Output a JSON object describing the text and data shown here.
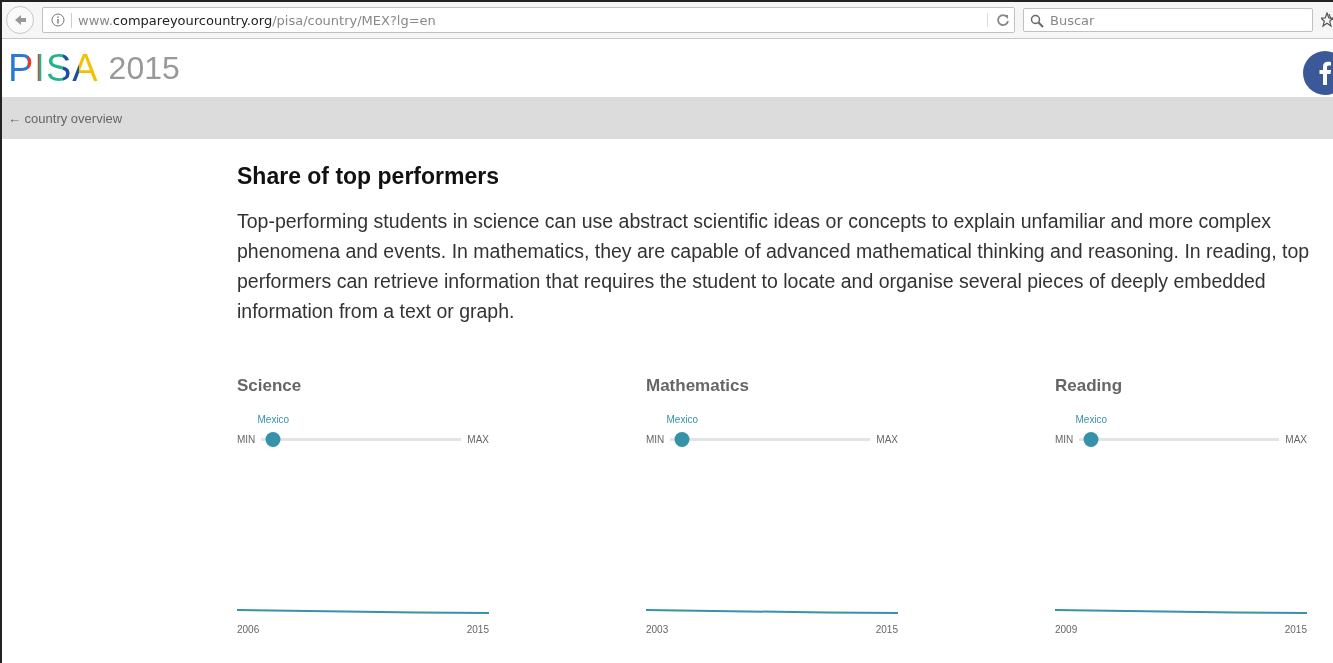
{
  "browser": {
    "url": "www.**compareyourcountry.org**/pisa/country/MEX?lg=en",
    "search": {
      "placeholder": "Buscar"
    }
  },
  "header": {
    "logo": "PISA",
    "year": "2015"
  },
  "nav": {
    "back_link": "← country overview"
  },
  "section": {
    "title": "Share of top performers",
    "description": "Top-performing students in science can use abstract scientific ideas or concepts to explain unfamiliar and more complex phenomena and events. In mathematics, they are capable of advanced mathematical thinking and reasoning. In reading, top performers can retrieve information that requires the student to locate and organise several pieces of deeply embedded information from a text or graph."
  },
  "panels": [
    {
      "title": "Science",
      "country": "Mexico",
      "min_label": "MIN",
      "max_label": "MAX",
      "level": 0.06,
      "start_year": "2006",
      "end_year": "2015"
    },
    {
      "title": "Mathematics",
      "country": "Mexico",
      "min_label": "MIN",
      "max_label": "MAX",
      "level": 0.06,
      "start_year": "2003",
      "end_year": "2015"
    },
    {
      "title": "Reading",
      "country": "Mexico",
      "min_label": "MIN",
      "max_label": "MAX",
      "level": 0.06,
      "start_year": "2009",
      "end_year": "2015"
    }
  ]
}
